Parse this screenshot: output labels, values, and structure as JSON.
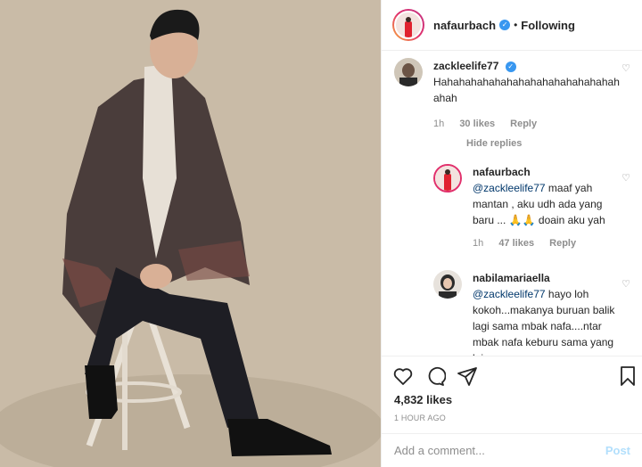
{
  "post": {
    "username": "nafaurbach",
    "follow_status": "Following",
    "likes": "4,832 likes",
    "timestamp": "1 HOUR AGO"
  },
  "comments": [
    {
      "username": "zackleelife77",
      "text": "Hahahahahahahahahahahahahahahahahah",
      "time": "1h",
      "likes": "30 likes",
      "reply": "Reply"
    }
  ],
  "hide_replies": "Hide replies",
  "replies": [
    {
      "username": "nafaurbach",
      "mention": "@zackleelife77",
      "text": " maaf yah mantan , aku udh ada yang baru ... 🙏🙏 doain aku yah",
      "time": "1h",
      "likes": "47 likes",
      "reply": "Reply"
    },
    {
      "username": "nabilamariaella",
      "mention": "@zackleelife77",
      "text": " hayo loh kokoh...makanya buruan balik lagi sama mbak nafa....ntar mbak nafa keburu sama yang lain"
    }
  ],
  "composer": {
    "placeholder": "Add a comment...",
    "post_label": "Post"
  },
  "icons": {
    "like": "heart-icon",
    "comment": "comment-icon",
    "share": "share-icon",
    "save": "bookmark-icon"
  }
}
